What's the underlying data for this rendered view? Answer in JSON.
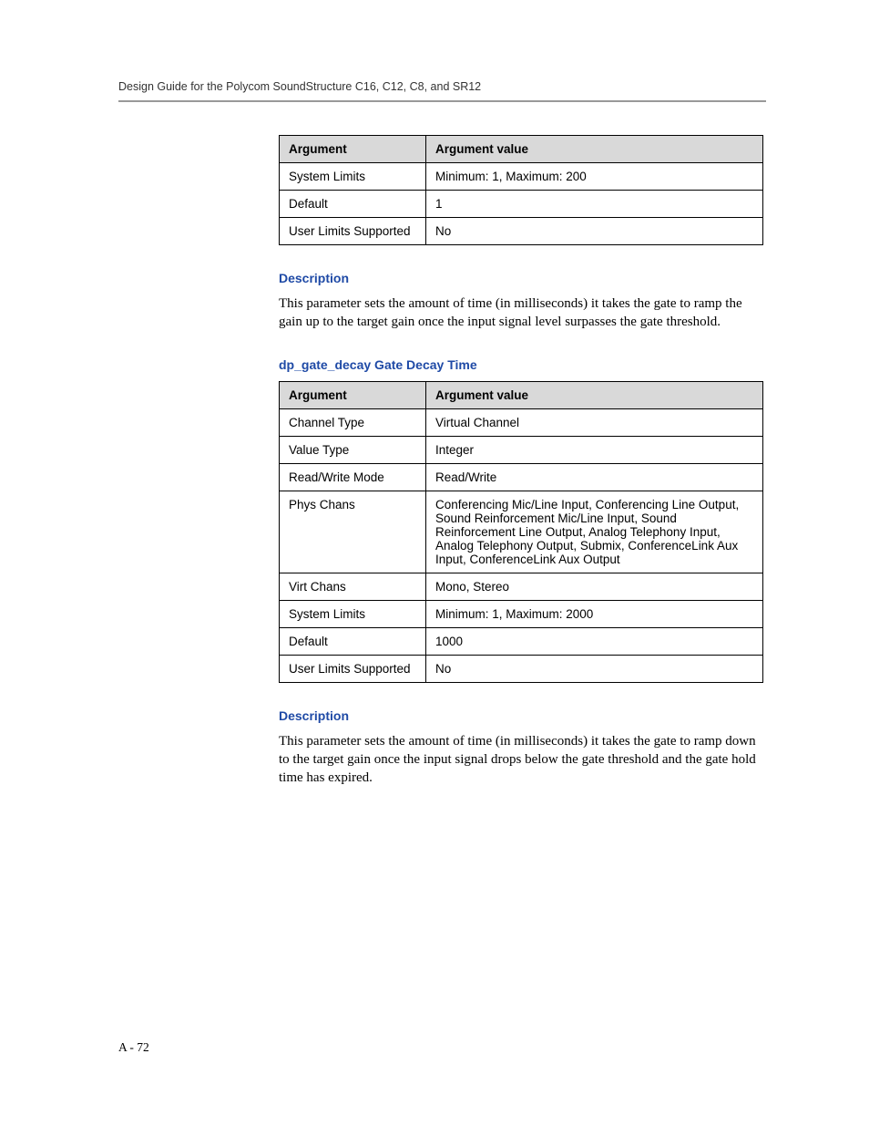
{
  "header": {
    "running": "Design Guide for the Polycom SoundStructure C16, C12, C8, and SR12"
  },
  "table1": {
    "head": {
      "arg": "Argument",
      "val": "Argument value"
    },
    "rows": [
      {
        "arg": "System Limits",
        "val": "Minimum: 1, Maximum: 200"
      },
      {
        "arg": "Default",
        "val": "1"
      },
      {
        "arg": "User Limits Supported",
        "val": "No"
      }
    ]
  },
  "desc1": {
    "label": "Description",
    "text": "This parameter sets the amount of time (in milliseconds) it takes the gate to ramp the gain up to the target gain once the input signal level surpasses the gate threshold."
  },
  "section2": {
    "title": "dp_gate_decay Gate Decay Time"
  },
  "table2": {
    "head": {
      "arg": "Argument",
      "val": "Argument value"
    },
    "rows": [
      {
        "arg": "Channel Type",
        "val": "Virtual Channel"
      },
      {
        "arg": "Value Type",
        "val": "Integer"
      },
      {
        "arg": "Read/Write Mode",
        "val": "Read/Write"
      },
      {
        "arg": "Phys Chans",
        "val": "Conferencing Mic/Line Input, Conferencing Line Output, Sound Reinforcement Mic/Line Input, Sound Reinforcement Line Output, Analog Telephony Input, Analog Telephony Output, Submix, ConferenceLink Aux Input, ConferenceLink Aux Output"
      },
      {
        "arg": "Virt Chans",
        "val": "Mono, Stereo"
      },
      {
        "arg": "System Limits",
        "val": "Minimum: 1, Maximum: 2000"
      },
      {
        "arg": "Default",
        "val": "1000"
      },
      {
        "arg": "User Limits Supported",
        "val": "No"
      }
    ]
  },
  "desc2": {
    "label": "Description",
    "text": "This parameter sets the amount of time (in milliseconds) it takes the gate to ramp down to the target gain once the input signal drops below the gate threshold and the gate hold time has expired."
  },
  "footer": {
    "pagenum": "A - 72"
  }
}
